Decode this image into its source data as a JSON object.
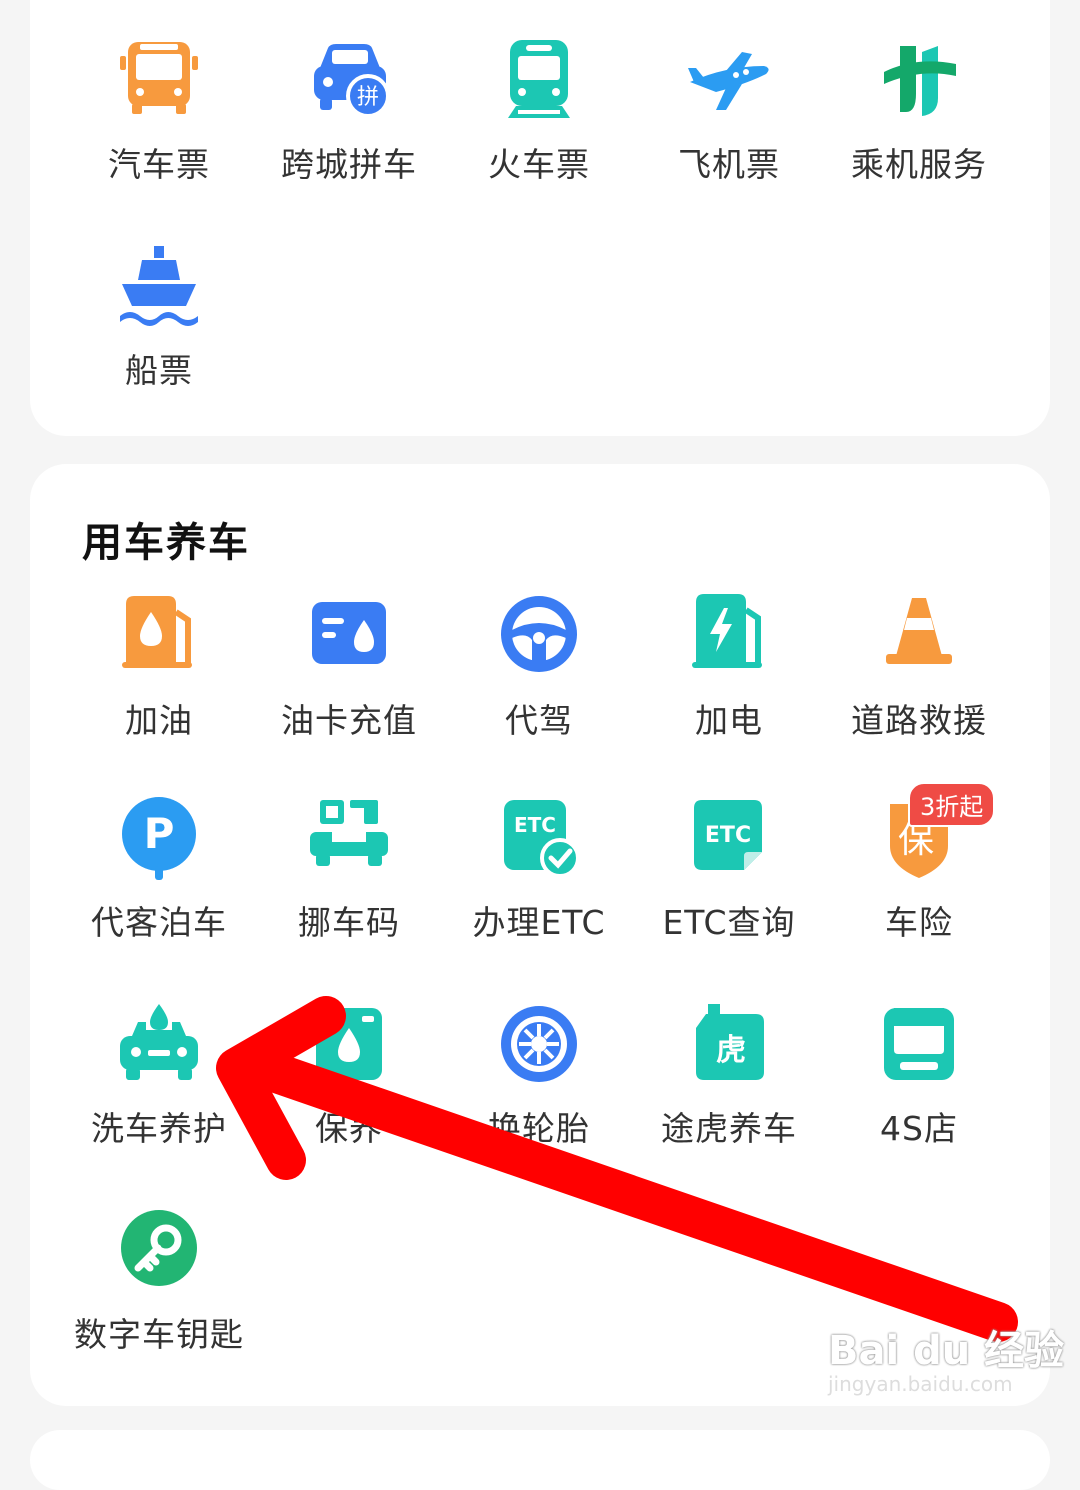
{
  "travel_section": {
    "items": [
      {
        "label": "汽车票",
        "icon": "bus-icon"
      },
      {
        "label": "跨城拼车",
        "icon": "carpool-icon",
        "icon_text": "拼"
      },
      {
        "label": "火车票",
        "icon": "train-icon"
      },
      {
        "label": "飞机票",
        "icon": "airplane-icon"
      },
      {
        "label": "乘机服务",
        "icon": "flight-service-icon"
      },
      {
        "label": "船票",
        "icon": "ship-icon"
      }
    ]
  },
  "car_section": {
    "title": "用车养车",
    "items": [
      {
        "label": "加油",
        "icon": "fuel-icon"
      },
      {
        "label": "油卡充值",
        "icon": "fuel-card-icon"
      },
      {
        "label": "代驾",
        "icon": "steering-wheel-icon"
      },
      {
        "label": "加电",
        "icon": "charging-icon"
      },
      {
        "label": "道路救援",
        "icon": "traffic-cone-icon"
      },
      {
        "label": "代客泊车",
        "icon": "parking-icon",
        "icon_text": "P"
      },
      {
        "label": "挪车码",
        "icon": "move-car-code-icon"
      },
      {
        "label": "办理ETC",
        "icon": "etc-apply-icon",
        "icon_text": "ETC"
      },
      {
        "label": "ETC查询",
        "icon": "etc-query-icon",
        "icon_text": "ETC"
      },
      {
        "label": "车险",
        "icon": "car-insurance-icon",
        "icon_text": "保",
        "badge": "3折起"
      },
      {
        "label": "洗车养护",
        "icon": "car-wash-icon"
      },
      {
        "label": "保养",
        "icon": "maintenance-icon"
      },
      {
        "label": "换轮胎",
        "icon": "tire-icon"
      },
      {
        "label": "途虎养车",
        "icon": "tuhu-icon",
        "icon_text": "虎"
      },
      {
        "label": "4S店",
        "icon": "shop-icon"
      },
      {
        "label": "数字车钥匙",
        "icon": "digital-key-icon"
      }
    ]
  },
  "watermark": {
    "logo": "Bai du 经验",
    "url": "jingyan.baidu.com"
  },
  "colors": {
    "orange": "#f79a3e",
    "blue": "#3a7cf3",
    "teal": "#1cc7b3",
    "red": "#ff0000",
    "badge": "#ef4b45"
  }
}
